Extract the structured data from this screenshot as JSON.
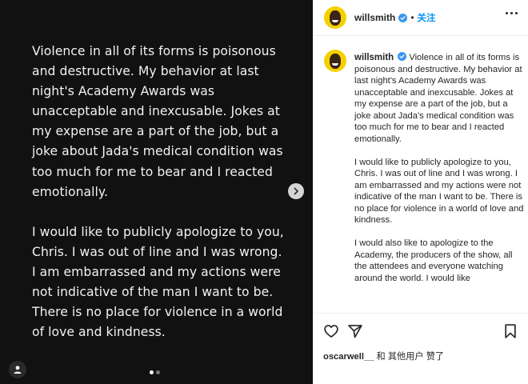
{
  "post": {
    "image_text": {
      "paragraph1": "Violence in all of its forms is poisonous and destructive. My behavior at last night's Academy Awards was unacceptable and inexcusable. Jokes at my expense are a part of the job, but a joke about Jada's medical condition was too much for me to bear and I reacted emotionally.",
      "paragraph2": "I would like to publicly apologize to you, Chris. I was out of line and I was wrong. I am embarrassed and my actions were not indicative of the man I want to be. There is no place for violence in a world of love and kindness."
    },
    "carousel": {
      "count": 2,
      "active_index": 0
    }
  },
  "header": {
    "username": "willsmith",
    "separator": "•",
    "follow_label": "关注"
  },
  "caption": {
    "username": "willsmith",
    "paragraph1": "Violence in all of its forms is poisonous and destructive. My behavior at last night's Academy Awards was unacceptable and inexcusable. Jokes at my expense are a part of the job, but a joke about Jada's medical condition was too much for me to bear and I reacted emotionally.",
    "paragraph2": "I would like to publicly apologize to you, Chris. I was out of line and I was wrong. I am embarrassed and my actions were not indicative of the man I want to be. There is no place for violence in a world of love and kindness.",
    "paragraph3": "I would also like to apologize to the Academy, the producers of the show, all the attendees and everyone watching around the world. I would like"
  },
  "likes": {
    "user": "oscarwell__",
    "text": " 和 其他用户 赞了"
  },
  "icons": {
    "verified": "verified-badge-icon",
    "more": "more-options-icon",
    "like": "heart-icon",
    "share": "paper-plane-icon",
    "save": "bookmark-icon",
    "next": "chevron-right-icon",
    "tag": "user-tag-icon"
  },
  "colors": {
    "media_background": "#111111",
    "link_blue": "#0095f6",
    "verified_blue": "#3897f0",
    "avatar_yellow": "#f5d000"
  }
}
